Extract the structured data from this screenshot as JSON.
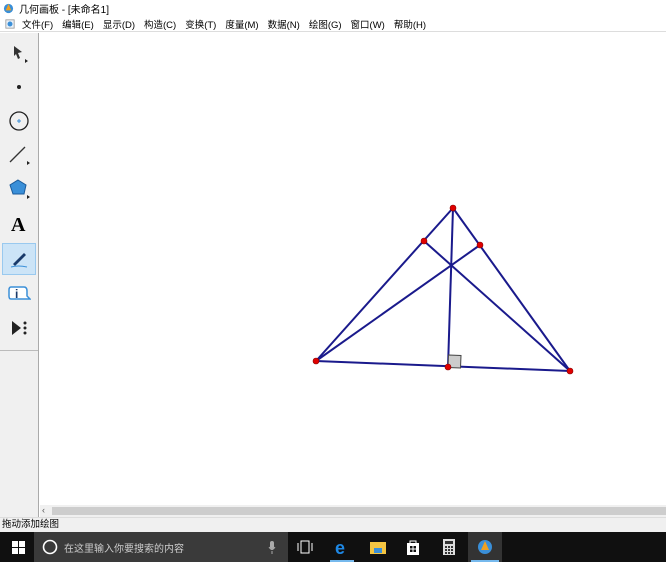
{
  "window": {
    "title": "几何画板 - [未命名1]"
  },
  "menu": [
    "文件(F)",
    "编辑(E)",
    "显示(D)",
    "构造(C)",
    "变换(T)",
    "度量(M)",
    "数据(N)",
    "绘图(G)",
    "窗口(W)",
    "帮助(H)"
  ],
  "toolbar": [
    "select-arrow-tool",
    "point-tool",
    "compass-tool",
    "straightedge-tool",
    "polygon-tool",
    "text-tool",
    "marker-tool",
    "information-tool",
    "custom-tool"
  ],
  "toolbar_selected": "marker-tool",
  "status": "拖动添加绘图",
  "taskbar": {
    "search_placeholder": "在这里输入你要搜索的内容"
  },
  "colors": {
    "segment": "#1a1a8c",
    "point": "#e00000",
    "accent": "#cce4f7"
  }
}
